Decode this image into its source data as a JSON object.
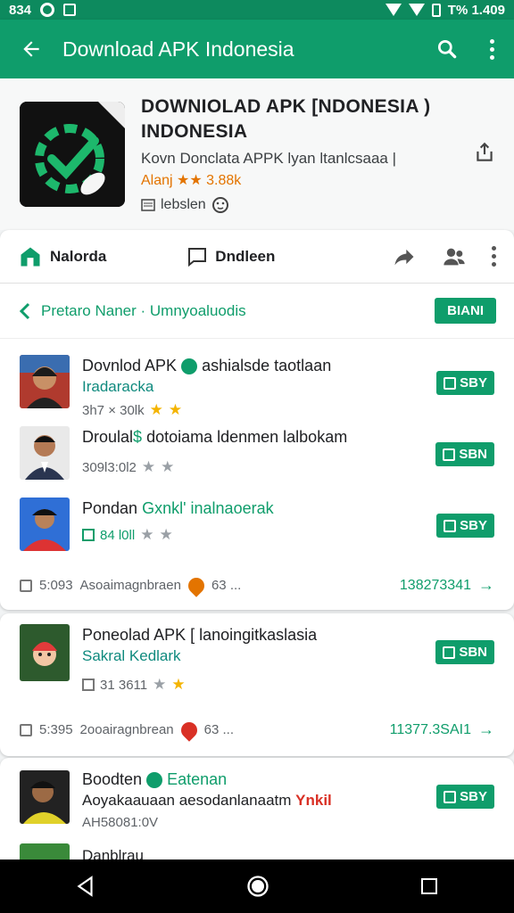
{
  "status_bar": {
    "time": "834",
    "right_text": "T% 1.409"
  },
  "app_bar": {
    "title": "Download APK Indonesia"
  },
  "app_header": {
    "title_line1": "DOWNIOLAD  APK [NDONESIA )",
    "title_line2": "INDONESIA",
    "subtitle": "Kovn Donclata APPK lyan ltanlcsaaa |",
    "rating": "Alanj ★★ 3.88k",
    "meta": "lebslen"
  },
  "action_row": {
    "left_label": "Nalorda",
    "middle_label": "Dndleen"
  },
  "section": {
    "title": "Pretaro Naner · Umnyoaluodis",
    "button": "BIANI"
  },
  "items": [
    {
      "title": "Dovnlod APK",
      "title_rest": "ashialsde taotlaan",
      "subtitle": "Iradaracka",
      "meta": "3h7 × 30lk",
      "button": "SBY"
    },
    {
      "title": "Droulal",
      "title_rest": "dotoiama ldenmen lalbokam",
      "subtitle": "",
      "meta": "309l3:0l2",
      "button": "SBN"
    },
    {
      "title": "Pondan",
      "title_rest": "Gxnkl' inalnaoerak",
      "subtitle": "",
      "meta": "84 l0ll",
      "button": "SBY"
    }
  ],
  "footer1": {
    "left": "5:093",
    "text": "Asoaimagnbraen",
    "badge": "63 ...",
    "count": "138273341"
  },
  "card2": {
    "title": "Poneolad APK [ lanoingitkaslasia",
    "subtitle": "Sakral Kedlark",
    "meta": "31 3611",
    "button": "SBN",
    "footer_left": "5:395",
    "footer_text": "2ooairagnbrean",
    "footer_badge": "63 ...",
    "footer_count": "11377.3SAI1"
  },
  "card3": {
    "title": "Boodten",
    "badge": "Eatenan",
    "subtitle": "Aoyakaauaan aesodanlanaatm",
    "subtitle_accent": "Ynkil",
    "meta": "AH58081:0V",
    "button": "SBY",
    "next_title": "Danblrau"
  },
  "colors": {
    "primary": "#0f9d6b",
    "accent": "#e37400",
    "teal_text": "#0f8a7e"
  }
}
